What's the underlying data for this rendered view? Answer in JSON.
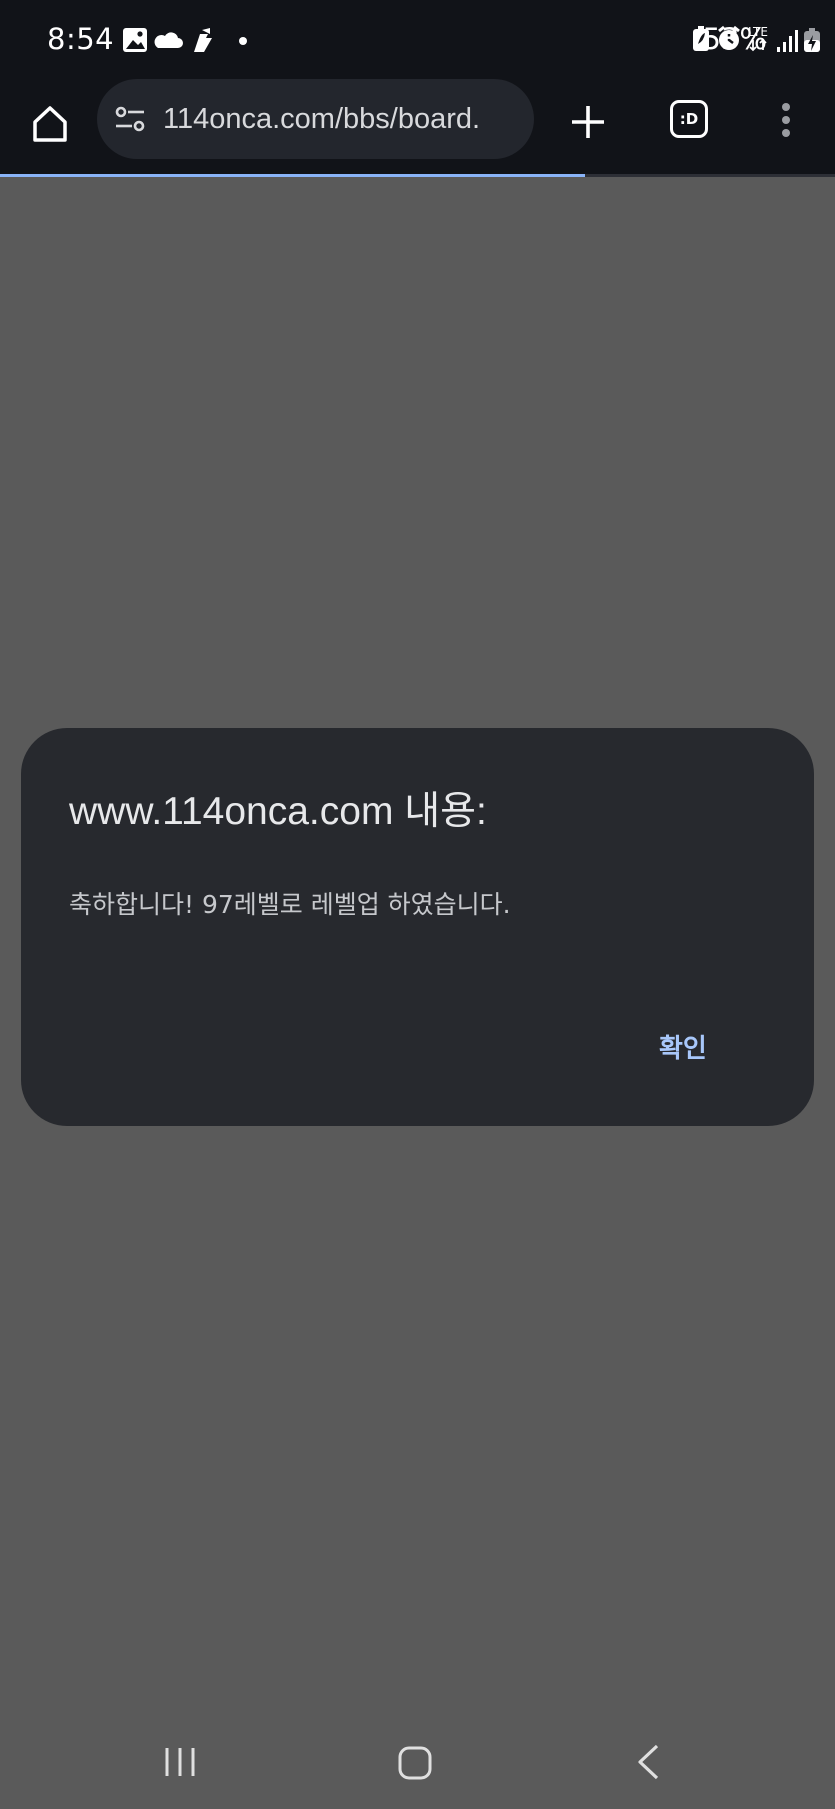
{
  "status_bar": {
    "time": "8:54",
    "battery_percent": "53%",
    "network_label": "LTE",
    "left_icons": [
      "gallery-icon",
      "cloud-icon",
      "app-notification-icon",
      "dot-icon"
    ],
    "right_icons": [
      "battery-saver-icon",
      "alarm-icon",
      "lte-icon",
      "signal-icon",
      "battery-charging-icon"
    ]
  },
  "browser": {
    "url": "114onca.com/bbs/board.",
    "tab_switcher_label": ":D",
    "load_progress": 0.7
  },
  "dialog": {
    "title": "www.114onca.com 내용:",
    "message": "축하합니다! 97레벨로 레벨업 하였습니다.",
    "ok_label": "확인"
  },
  "colors": {
    "page_background": "#5a5a5a",
    "toolbar_background": "#111318",
    "dialog_background": "#27292e",
    "accent": "#a8c7fa"
  }
}
